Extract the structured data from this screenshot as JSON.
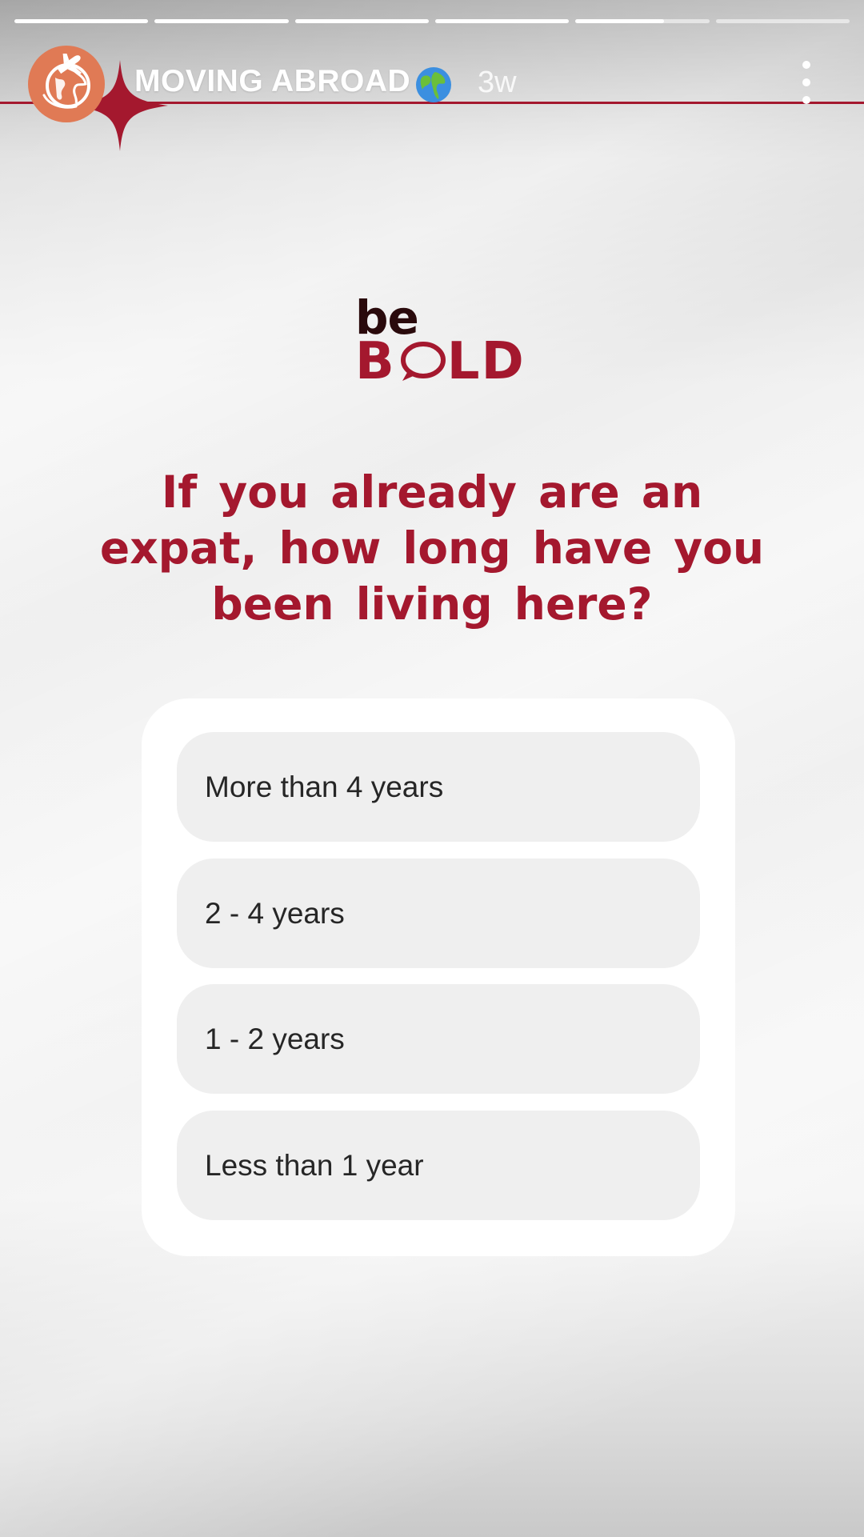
{
  "story": {
    "progress_segments": [
      1,
      1,
      1,
      1,
      0.66,
      0
    ],
    "account_name": "MOVING ABROAD",
    "name_emoji": "globe-emoji",
    "time_ago": "3w",
    "accent_color": "#a4182e",
    "avatar_color": "#e07a55"
  },
  "logo": {
    "line1": "be",
    "line2_before": "B",
    "line2_after": "LD"
  },
  "question": "If you already are an expat, how long have you been living here?",
  "quiz": {
    "options": [
      {
        "label": "More than 4 years"
      },
      {
        "label": "2 - 4 years"
      },
      {
        "label": "1 - 2 years"
      },
      {
        "label": "Less than 1 year"
      }
    ]
  }
}
